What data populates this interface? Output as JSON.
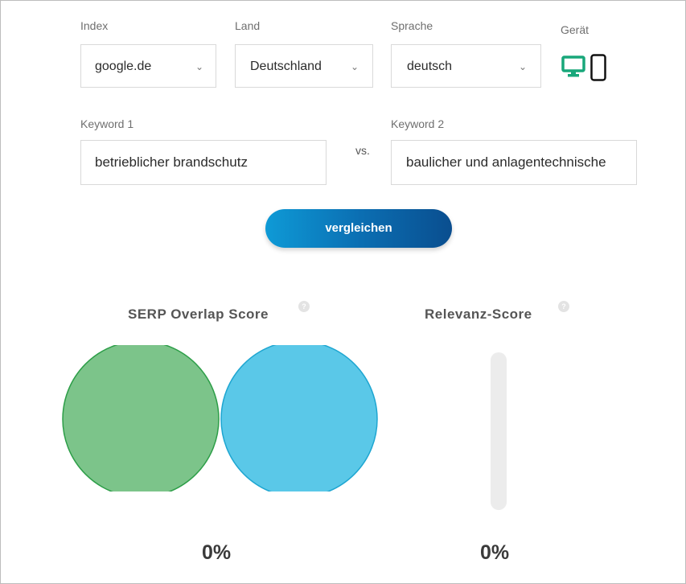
{
  "filters": {
    "index": {
      "label": "Index",
      "value": "google.de"
    },
    "land": {
      "label": "Land",
      "value": "Deutschland"
    },
    "sprache": {
      "label": "Sprache",
      "value": "deutsch"
    },
    "geraet": {
      "label": "Gerät",
      "selected": "desktop"
    }
  },
  "keywords": {
    "keyword1": {
      "label": "Keyword 1",
      "value": "betrieblicher brandschutz"
    },
    "vs_label": "vs.",
    "keyword2": {
      "label": "Keyword 2",
      "value": "baulicher und anlagentechnische"
    }
  },
  "compare_button": "vergleichen",
  "results": {
    "serp_overlap": {
      "title": "SERP Overlap Score",
      "help": "?",
      "value": "0%",
      "colors": {
        "left": "#7cc48a",
        "right": "#5ac8e8"
      }
    },
    "relevanz": {
      "title": "Relevanz-Score",
      "help": "?",
      "value": "0%",
      "fraction": 0
    }
  },
  "colors": {
    "accent_green": "#18a77a",
    "button_start": "#0e9ad6",
    "button_end": "#0a4e8f"
  }
}
